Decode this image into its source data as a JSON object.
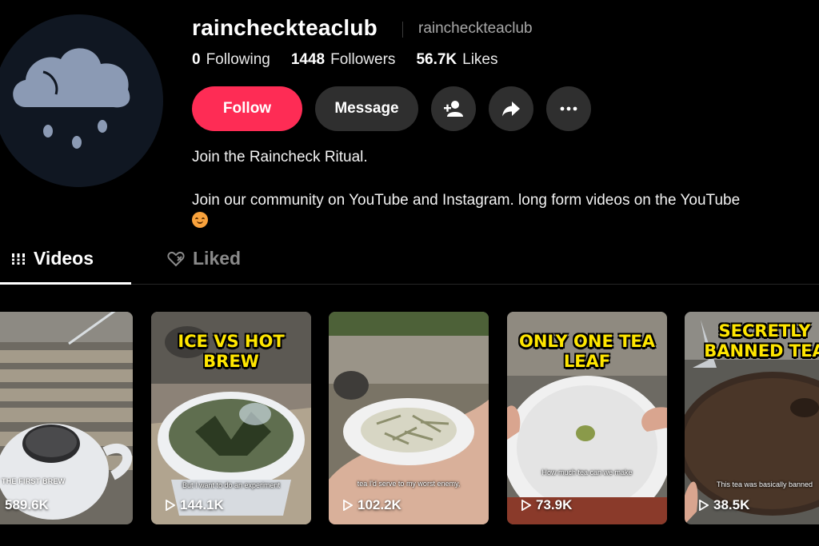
{
  "profile": {
    "username": "raincheckteaclub",
    "nickname": "raincheckteaclub",
    "stats": [
      {
        "value": "0",
        "label": "Following"
      },
      {
        "value": "1448",
        "label": "Followers"
      },
      {
        "value": "56.7K",
        "label": "Likes"
      }
    ],
    "bio_line1": "Join the Raincheck Ritual.",
    "bio_line2": "Join our community on YouTube and Instagram. long form videos on the YouTube"
  },
  "actions": {
    "follow_label": "Follow",
    "message_label": "Message",
    "icons": [
      "add-friend-icon",
      "share-icon",
      "more-icon"
    ]
  },
  "tabs": [
    {
      "label": "Videos",
      "icon": "grid-icon",
      "active": true
    },
    {
      "label": "Liked",
      "icon": "liked-heart-icon",
      "active": false
    }
  ],
  "videos": [
    {
      "views": "589.6K",
      "headline": "",
      "badge": "THE FIRST BREW",
      "caption": ""
    },
    {
      "views": "144.1K",
      "headline": "ICE VS HOT BREW",
      "badge": "",
      "caption": "But I want to do an experiment"
    },
    {
      "views": "102.2K",
      "headline": "",
      "badge": "",
      "caption": "tea I'd serve to my worst enemy,"
    },
    {
      "views": "73.9K",
      "headline": "ONLY ONE TEA LEAF",
      "badge": "",
      "caption": "How much tea can we make"
    },
    {
      "views": "38.5K",
      "headline": "SECRETLY BANNED TEA",
      "badge": "",
      "caption": "This tea was basically banned"
    }
  ],
  "colors": {
    "follow": "#fe2c55",
    "button_dark": "#2f2f2f",
    "background": "#000000",
    "headline_yellow": "#ffe600"
  }
}
